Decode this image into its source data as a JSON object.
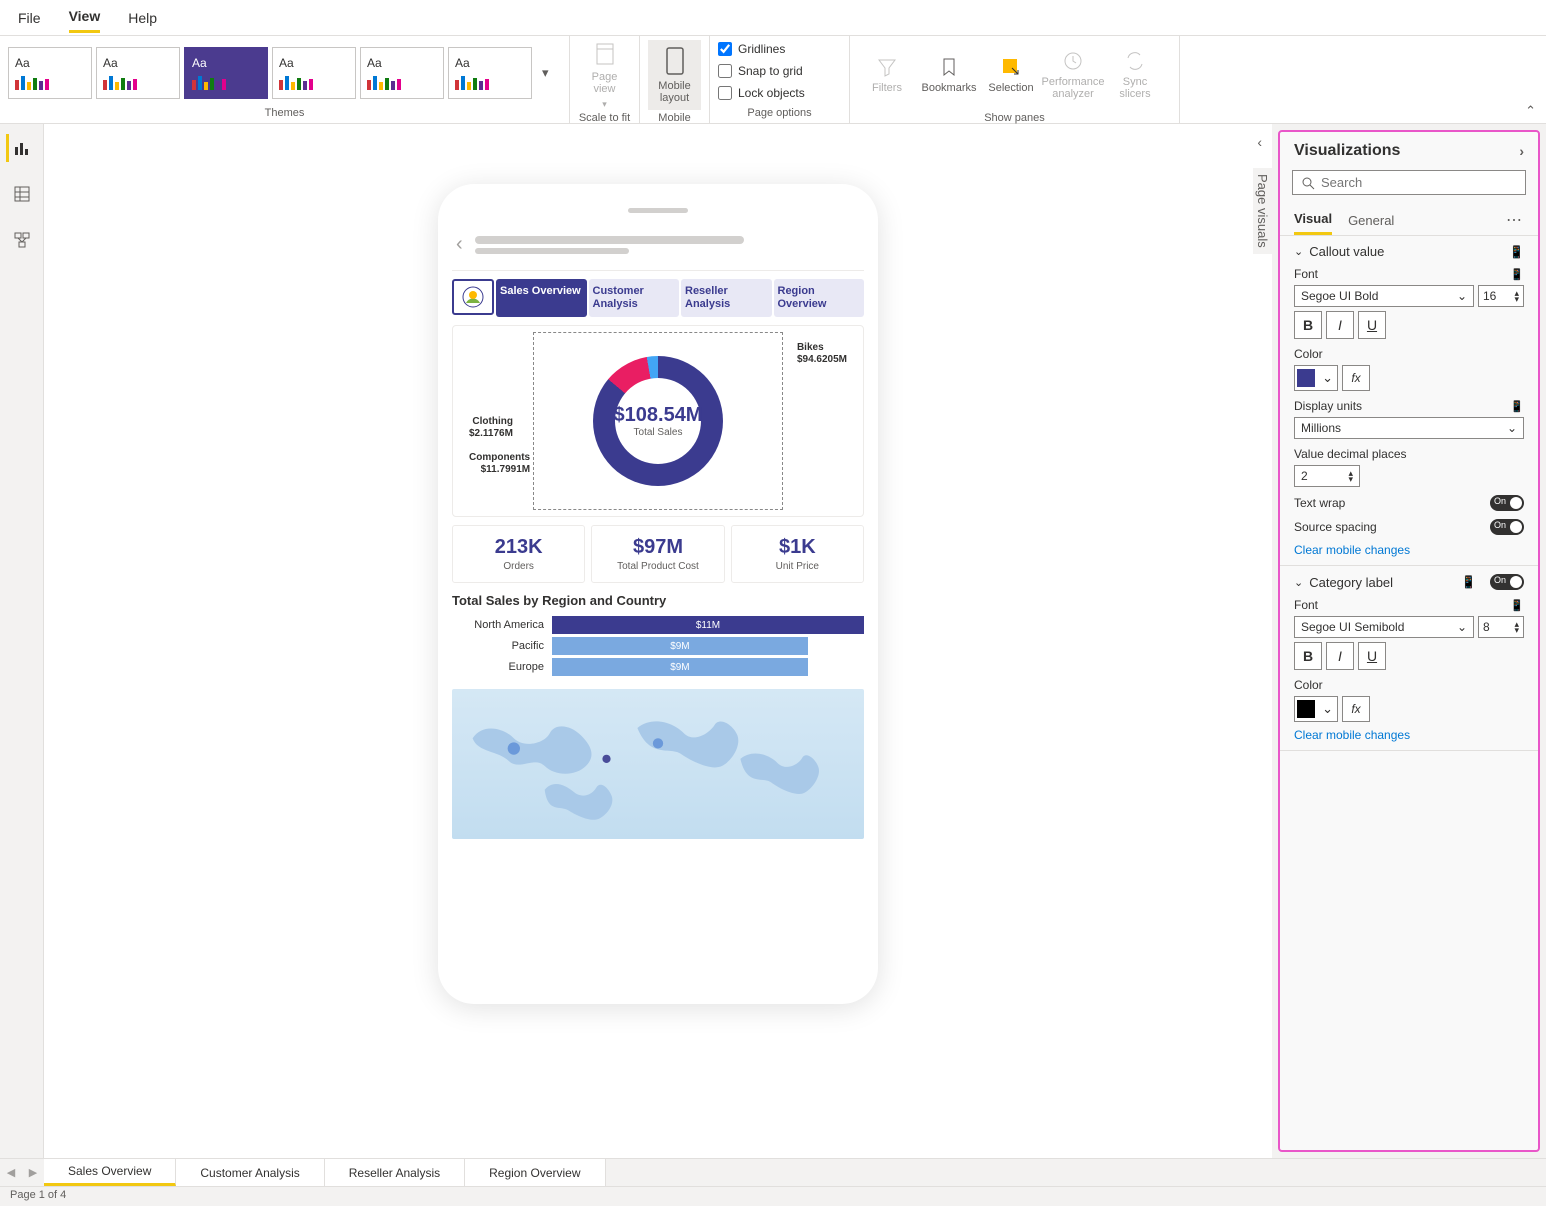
{
  "menu": {
    "file": "File",
    "view": "View",
    "help": "Help"
  },
  "ribbon": {
    "themes_label": "Themes",
    "scale_to_fit": "Scale to fit",
    "page_view": "Page view",
    "mobile_label": "Mobile",
    "mobile_layout": "Mobile layout",
    "page_options": "Page options",
    "gridlines": "Gridlines",
    "snap": "Snap to grid",
    "lock": "Lock objects",
    "show_panes": "Show panes",
    "filters": "Filters",
    "bookmarks": "Bookmarks",
    "selection": "Selection",
    "perf": "Performance analyzer",
    "sync": "Sync slicers"
  },
  "side_label": "Page visuals",
  "phone": {
    "tabs": [
      "Sales Overview",
      "Customer Analysis",
      "Reseller Analysis",
      "Region Overview"
    ],
    "donut": {
      "center_val": "$108.54M",
      "center_lbl": "Total Sales",
      "labels": [
        {
          "name": "Bikes",
          "val": "$94.6205M"
        },
        {
          "name": "Clothing",
          "val": "$2.1176M"
        },
        {
          "name": "Components",
          "val": "$11.7991M"
        }
      ]
    },
    "kpis": [
      {
        "val": "213K",
        "lbl": "Orders"
      },
      {
        "val": "$97M",
        "lbl": "Total Product Cost"
      },
      {
        "val": "$1K",
        "lbl": "Unit Price"
      }
    ],
    "bar_title": "Total Sales by Region and Country",
    "bars": [
      {
        "name": "North America",
        "val": "$11M",
        "pct": 100,
        "color": "#3b3b8f"
      },
      {
        "name": "Pacific",
        "val": "$9M",
        "pct": 82,
        "color": "#7aa9e0"
      },
      {
        "name": "Europe",
        "val": "$9M",
        "pct": 82,
        "color": "#7aa9e0"
      }
    ]
  },
  "viz": {
    "title": "Visualizations",
    "search": "Search",
    "tab_visual": "Visual",
    "tab_general": "General",
    "callout": {
      "title": "Callout value",
      "font_lbl": "Font",
      "font": "Segoe UI Bold",
      "size": "16",
      "color_lbl": "Color",
      "color": "#3b3b8f",
      "units_lbl": "Display units",
      "units": "Millions",
      "decimals_lbl": "Value decimal places",
      "decimals": "2",
      "wrap": "Text wrap",
      "spacing": "Source spacing",
      "clear": "Clear mobile changes"
    },
    "category": {
      "title": "Category label",
      "font_lbl": "Font",
      "font": "Segoe UI Semibold",
      "size": "8",
      "color_lbl": "Color",
      "color": "#000000",
      "clear": "Clear mobile changes"
    }
  },
  "pages": {
    "tabs": [
      "Sales Overview",
      "Customer Analysis",
      "Reseller Analysis",
      "Region Overview"
    ],
    "status": "Page 1 of 4"
  },
  "chart_data": {
    "donut": {
      "type": "pie",
      "title": "Total Sales",
      "total": 108.54,
      "unit": "$M",
      "series": [
        {
          "name": "Bikes",
          "value": 94.6205
        },
        {
          "name": "Components",
          "value": 11.7991
        },
        {
          "name": "Clothing",
          "value": 2.1176
        }
      ]
    },
    "kpis": [
      {
        "label": "Orders",
        "value": 213000
      },
      {
        "label": "Total Product Cost",
        "value": 97000000
      },
      {
        "label": "Unit Price",
        "value": 1000
      }
    ],
    "bars": {
      "type": "bar",
      "title": "Total Sales by Region and Country",
      "unit": "$M",
      "categories": [
        "North America",
        "Pacific",
        "Europe"
      ],
      "values": [
        11,
        9,
        9
      ]
    }
  }
}
